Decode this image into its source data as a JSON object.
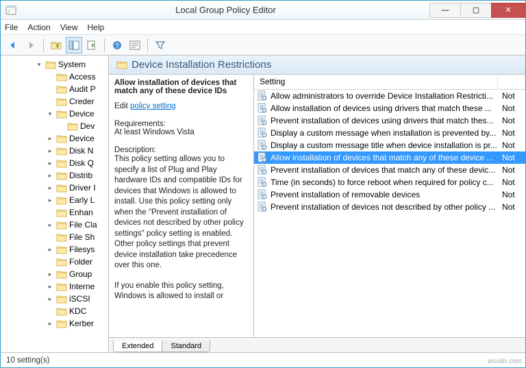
{
  "window": {
    "title": "Local Group Policy Editor"
  },
  "menu": {
    "file": "File",
    "action": "Action",
    "view": "View",
    "help": "Help"
  },
  "tree": {
    "root": {
      "label": "System",
      "expand": "▾"
    },
    "items": [
      {
        "arrow": "",
        "label": "Access"
      },
      {
        "arrow": "",
        "label": "Audit P"
      },
      {
        "arrow": "",
        "label": "Creder"
      },
      {
        "arrow": "▾",
        "label": "Device",
        "children": [
          {
            "arrow": "",
            "label": "Dev",
            "indent": 1
          }
        ]
      },
      {
        "arrow": "▸",
        "label": "Device"
      },
      {
        "arrow": "▸",
        "label": "Disk N"
      },
      {
        "arrow": "▸",
        "label": "Disk Q"
      },
      {
        "arrow": "▸",
        "label": "Distrib"
      },
      {
        "arrow": "▸",
        "label": "Driver I"
      },
      {
        "arrow": "▸",
        "label": "Early L"
      },
      {
        "arrow": "",
        "label": "Enhan"
      },
      {
        "arrow": "▸",
        "label": "File Cla"
      },
      {
        "arrow": "",
        "label": "File Sh"
      },
      {
        "arrow": "▸",
        "label": "Filesys"
      },
      {
        "arrow": "",
        "label": "Folder"
      },
      {
        "arrow": "▸",
        "label": "Group"
      },
      {
        "arrow": "▸",
        "label": "Interne"
      },
      {
        "arrow": "▸",
        "label": "iSCSI"
      },
      {
        "arrow": "",
        "label": "KDC"
      },
      {
        "arrow": "▸",
        "label": "Kerber"
      }
    ]
  },
  "header": {
    "title": "Device Installation Restrictions"
  },
  "desc": {
    "title1": "Allow installation of devices that",
    "title2": "match any of these device IDs",
    "edit": "Edit",
    "link": "policy setting",
    "req_h": "Requirements:",
    "req_v": "At least Windows Vista",
    "desc_h": "Description:",
    "desc_v": "This policy setting allows you to specify a list of Plug and Play hardware IDs and compatible IDs for devices that Windows is allowed to install. Use this policy setting only when the \"Prevent installation of devices not described by other policy settings\" policy setting is enabled. Other policy settings that prevent device installation take precedence over this one.",
    "enable": "If you enable this policy setting, Windows is allowed to install or"
  },
  "list": {
    "col_setting": "Setting",
    "rows": [
      {
        "label": "Allow administrators to override Device Installation Restricti...",
        "state": "Not"
      },
      {
        "label": "Allow installation of devices using drivers that match these ...",
        "state": "Not"
      },
      {
        "label": "Prevent installation of devices using drivers that match thes...",
        "state": "Not"
      },
      {
        "label": "Display a custom message when installation is prevented by...",
        "state": "Not"
      },
      {
        "label": "Display a custom message title when device installation is pr...",
        "state": "Not"
      },
      {
        "label": "Allow installation of devices that match any of these device ...",
        "state": "Not",
        "sel": true
      },
      {
        "label": "Prevent installation of devices that match any of these devic...",
        "state": "Not"
      },
      {
        "label": "Time (in seconds) to force reboot when required for policy c...",
        "state": "Not"
      },
      {
        "label": "Prevent installation of removable devices",
        "state": "Not"
      },
      {
        "label": "Prevent installation of devices not described by other policy ...",
        "state": "Not"
      }
    ]
  },
  "tabs": {
    "extended": "Extended",
    "standard": "Standard"
  },
  "status": {
    "text": "10 setting(s)"
  },
  "watermark": "wsxdn.com"
}
